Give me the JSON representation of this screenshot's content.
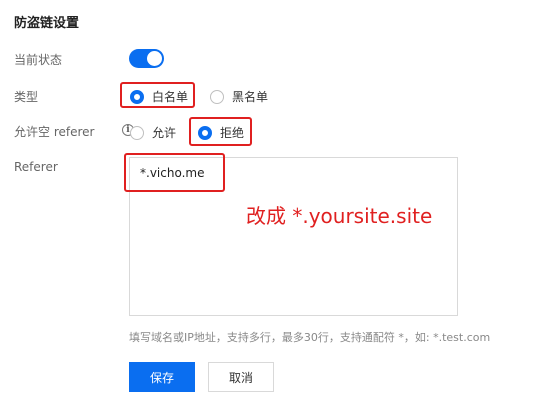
{
  "title": "防盗链设置",
  "status": {
    "label": "当前状态",
    "enabled": true
  },
  "type": {
    "label": "类型",
    "options": [
      {
        "label": "白名单",
        "checked": true
      },
      {
        "label": "黑名单",
        "checked": false
      }
    ]
  },
  "allow_empty": {
    "label": "允许空 referer",
    "info_icon": "info-icon",
    "options": [
      {
        "label": "允许",
        "checked": false
      },
      {
        "label": "拒绝",
        "checked": true
      }
    ]
  },
  "referer": {
    "label": "Referer",
    "value": "*.vicho.me",
    "annotation": "改成 *.yoursite.site",
    "hint": "填写域名或IP地址，支持多行，最多30行，支持通配符 *，如: *.test.com"
  },
  "buttons": {
    "save": "保存",
    "cancel": "取消"
  },
  "colors": {
    "accent": "#0a6ef0",
    "annotation_red": "#e02020"
  }
}
